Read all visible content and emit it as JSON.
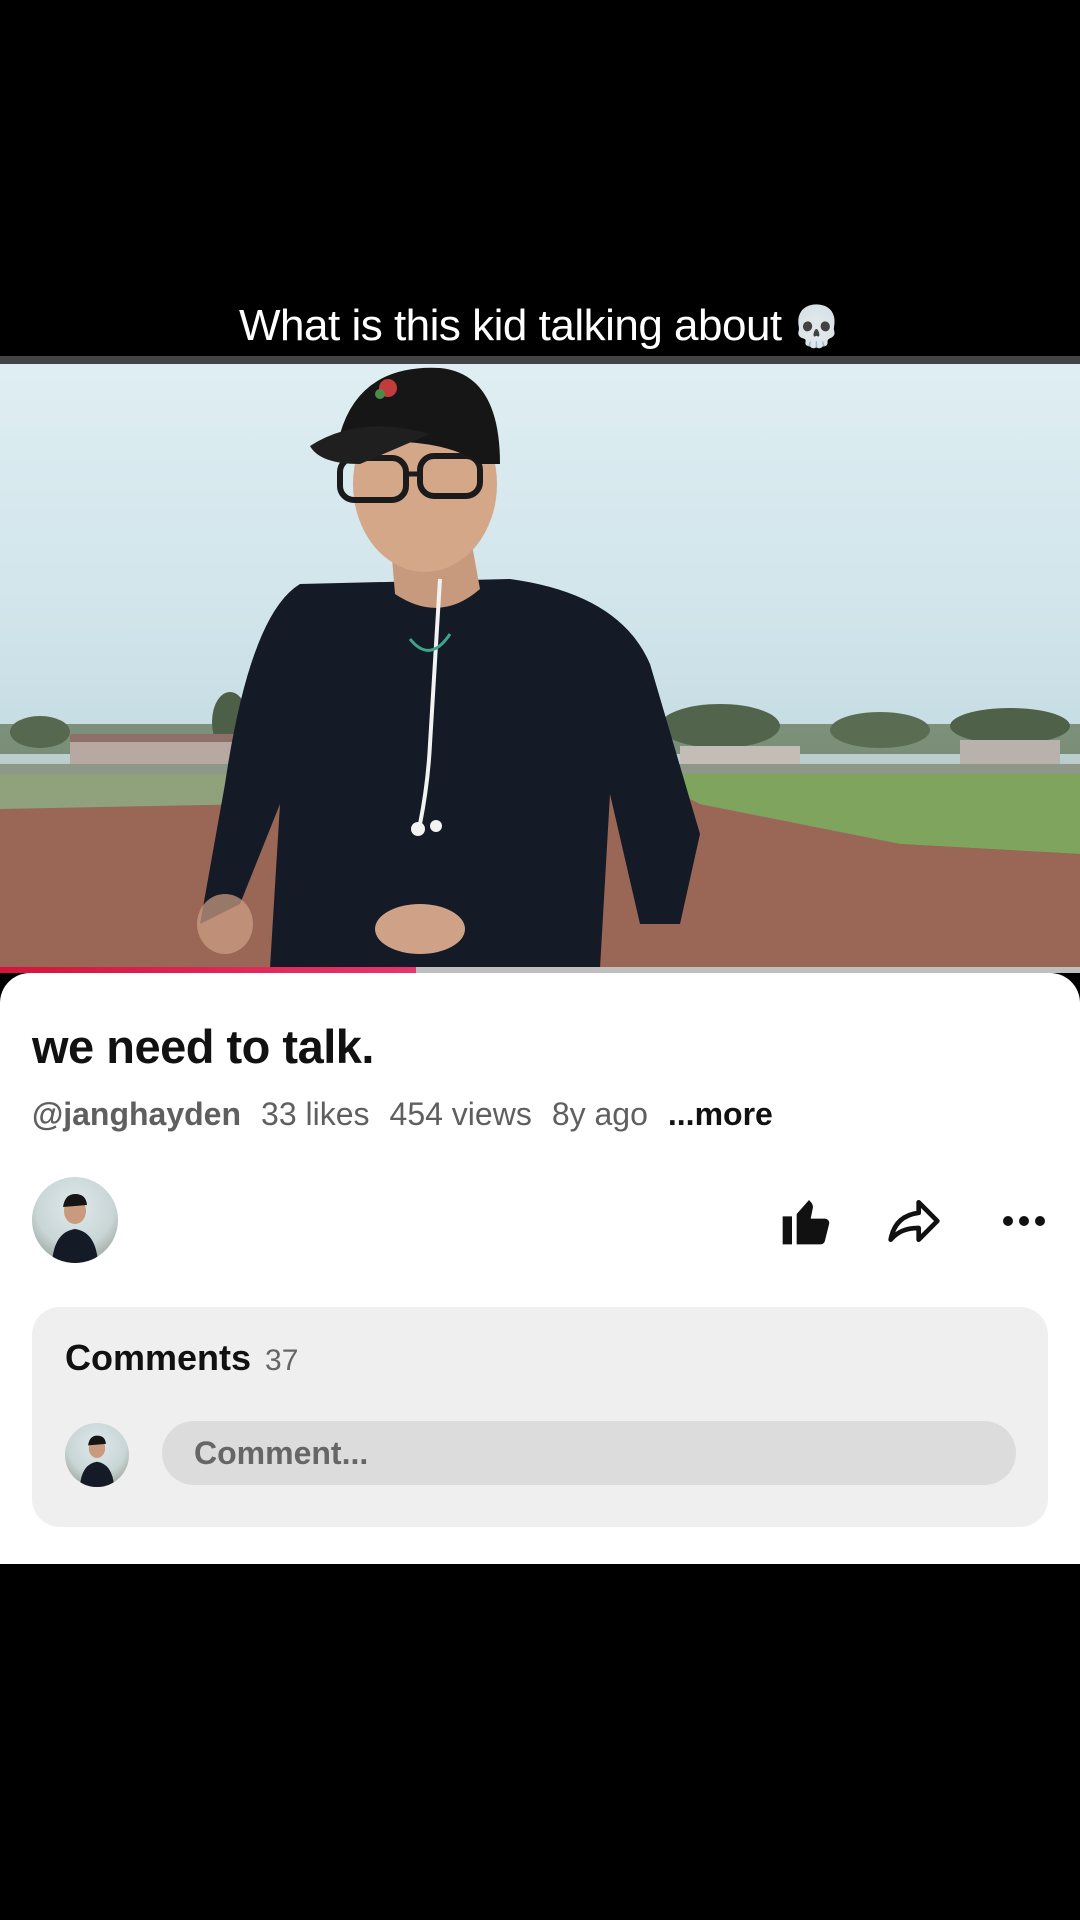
{
  "caption": {
    "text": "What is this kid talking about",
    "emoji": "💀"
  },
  "player": {
    "progress_fraction": 0.385
  },
  "video": {
    "title": "we need to talk.",
    "channel_handle": "@janghayden",
    "likes": "33 likes",
    "views": "454 views",
    "age": "8y ago",
    "more_label": "...more"
  },
  "actions": {
    "like_icon": "thumbs-up-icon",
    "share_icon": "share-arrow-icon",
    "more_icon": "more-horizontal-icon"
  },
  "comments": {
    "title": "Comments",
    "count": "37",
    "input_placeholder": "Comment..."
  }
}
